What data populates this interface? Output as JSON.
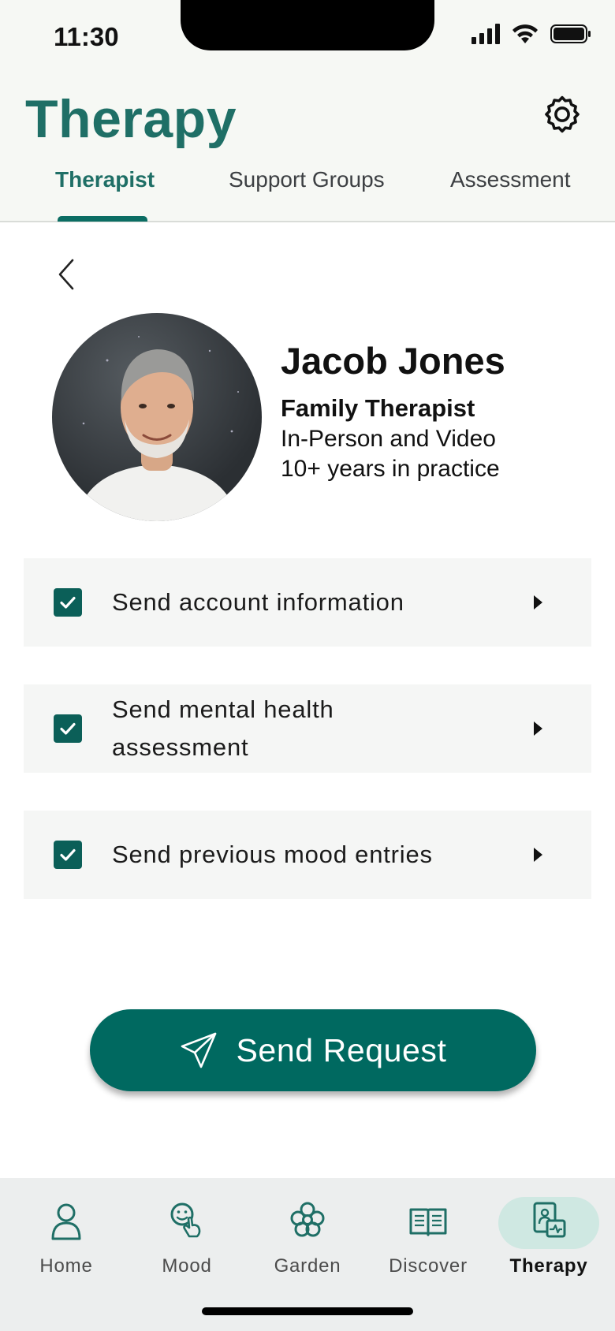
{
  "status_bar": {
    "time": "11:30"
  },
  "header": {
    "title": "Therapy"
  },
  "tabs": [
    {
      "label": "Therapist",
      "active": true
    },
    {
      "label": "Support Groups",
      "active": false
    },
    {
      "label": "Assessment",
      "active": false
    }
  ],
  "therapist": {
    "name": "Jacob Jones",
    "role": "Family Therapist",
    "mode": "In-Person and Video",
    "experience": "10+ years in practice"
  },
  "options": [
    {
      "label": "Send account information",
      "checked": true
    },
    {
      "label": "Send mental health assessment",
      "checked": true
    },
    {
      "label": "Send previous mood entries",
      "checked": true
    }
  ],
  "send_button": {
    "label": "Send Request"
  },
  "bottom_nav": [
    {
      "label": "Home",
      "icon": "person-icon",
      "active": false
    },
    {
      "label": "Mood",
      "icon": "mood-icon",
      "active": false
    },
    {
      "label": "Garden",
      "icon": "flower-icon",
      "active": false
    },
    {
      "label": "Discover",
      "icon": "book-icon",
      "active": false
    },
    {
      "label": "Therapy",
      "icon": "therapy-icon",
      "active": true
    }
  ],
  "colors": {
    "accent": "#1f6f66",
    "button": "#006960",
    "checkbox": "#0b5f58",
    "nav_pill": "#cfe8e2"
  }
}
